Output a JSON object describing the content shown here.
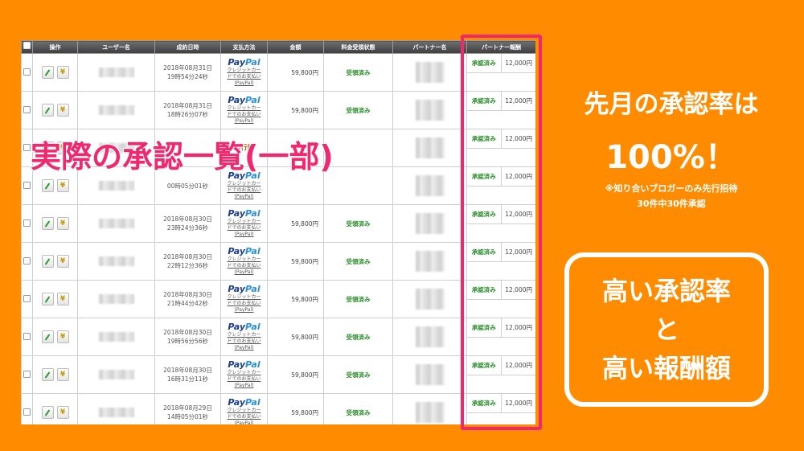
{
  "table": {
    "headers": [
      "操作",
      "ユーザー名",
      "成約日時",
      "支払方法",
      "金額",
      "料金受領状態",
      "パートナー名",
      "パートナー報酬"
    ],
    "rows": [
      {
        "date1": "2018年08月31日",
        "date2": "19時54分24秒",
        "amount": "59,800円",
        "status": "受領済み",
        "reward_status": "承認済み",
        "reward": "12,000円"
      },
      {
        "date1": "2018年08月31日",
        "date2": "18時26分07秒",
        "amount": "59,800円",
        "status": "受領済み",
        "reward_status": "承認済み",
        "reward": "12,000円"
      },
      {
        "date1": "",
        "date2": "",
        "amount": "",
        "status": "",
        "reward_status": "承認済み",
        "reward": "12,000円"
      },
      {
        "date1": "",
        "date2": "00時05分01秒",
        "amount": "",
        "status": "",
        "reward_status": "承認済み",
        "reward": "12,000円"
      },
      {
        "date1": "2018年08月30日",
        "date2": "23時24分36秒",
        "amount": "59,800円",
        "status": "受領済み",
        "reward_status": "承認済み",
        "reward": "12,000円"
      },
      {
        "date1": "2018年08月30日",
        "date2": "22時12分36秒",
        "amount": "59,800円",
        "status": "受領済み",
        "reward_status": "承認済み",
        "reward": "12,000円"
      },
      {
        "date1": "2018年08月30日",
        "date2": "21時44分42秒",
        "amount": "59,800円",
        "status": "受領済み",
        "reward_status": "承認済み",
        "reward": "12,000円"
      },
      {
        "date1": "2018年08月30日",
        "date2": "19時56分56秒",
        "amount": "59,800円",
        "status": "受領済み",
        "reward_status": "承認済み",
        "reward": "12,000円"
      },
      {
        "date1": "2018年08月30日",
        "date2": "16時31分11秒",
        "amount": "59,800円",
        "status": "受領済み",
        "reward_status": "承認済み",
        "reward": "12,000円"
      },
      {
        "date1": "2018年08月29日",
        "date2": "14時05分01秒",
        "amount": "59,800円",
        "status": "受領済み",
        "reward_status": "承認済み",
        "reward": "12,000円"
      }
    ],
    "payment": {
      "brand_pay": "Pay",
      "brand_pal": "Pal",
      "line1": "クレジットカー",
      "line2": "ドでのお支払い",
      "line3": "(PayPal)"
    },
    "partial_payment": "銀行振"
  },
  "overlay_text": "実際の承認一覧(一部)",
  "side": {
    "headline": "先月の承認率は",
    "rate": "100%！",
    "note1": "※知り合いブロガーのみ先行招待",
    "note2": "30件中30件承認",
    "box_line1": "高い承認率",
    "box_line2": "と",
    "box_line3": "高い報酬額"
  },
  "colors": {
    "background": "#FF8C00",
    "highlight": "#F0286E",
    "status_green": "#2A8C2A",
    "paypal_dark": "#1B3F8F",
    "paypal_light": "#2C8ED6"
  }
}
